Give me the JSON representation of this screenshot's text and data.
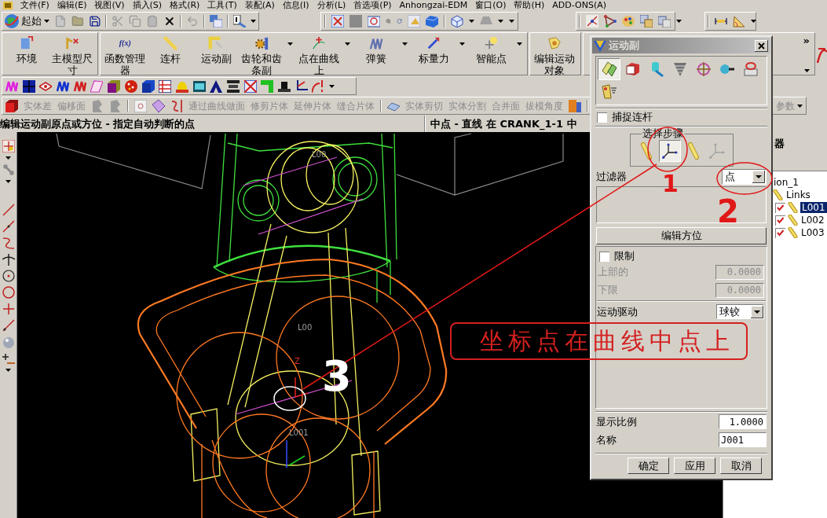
{
  "menu_bar": [
    "文件(F)",
    "编辑(E)",
    "视图(V)",
    "插入(S)",
    "格式(R)",
    "工具(T)",
    "装配(A)",
    "信息(I)",
    "分析(L)",
    "首选项(P)",
    "Anhongzai-EDM",
    "窗口(O)",
    "帮助(H)",
    "ADD-ONS(A)"
  ],
  "standard_toolbar": {
    "start_button": "起始"
  },
  "motion_toolbar": {
    "groups": [
      [
        {
          "label": "环境",
          "dropdown": false
        },
        {
          "label": "主模型尺寸",
          "dropdown": false
        }
      ],
      [
        {
          "label": "函数管理器",
          "dropdown": false,
          "icon_text": "f(x)"
        },
        {
          "label": "连杆",
          "dropdown": false
        },
        {
          "label": "运动副",
          "dropdown": false
        },
        {
          "label": "齿轮和齿条副",
          "dropdown": true
        },
        {
          "label": "点在曲线上",
          "dropdown": true
        },
        {
          "label": "弹簧",
          "dropdown": true
        },
        {
          "label": "标量力",
          "dropdown": true
        },
        {
          "label": "智能点",
          "dropdown": true
        }
      ],
      [
        {
          "label": "编辑运动对象",
          "dropdown": false
        }
      ]
    ],
    "overflow": "»"
  },
  "feature_toolbar": {
    "groups": [
      [
        {
          "label": "实体差",
          "disabled": true
        },
        {
          "label": "偏移面",
          "disabled": true
        }
      ],
      [
        {
          "label": "通过曲线做面",
          "disabled": true
        },
        {
          "label": "修剪片体",
          "disabled": true
        },
        {
          "label": "延伸片体",
          "disabled": true
        },
        {
          "label": "缝合片体",
          "disabled": true
        }
      ],
      [
        {
          "label": "实体剪切",
          "disabled": true
        },
        {
          "label": "实体分割",
          "disabled": true
        },
        {
          "label": "合并面",
          "disabled": true
        },
        {
          "label": "拔模角度",
          "disabled": true
        }
      ]
    ],
    "trailing": {
      "label": "参数",
      "disabled": true
    }
  },
  "status_bar": {
    "prompt": "编辑运动副原点或方位 - 指定自动判断的点",
    "selection": "中点 - 直线 在 CRANK_1-1 中"
  },
  "viewport": {
    "labels": [
      {
        "text": "L00",
        "kind": "link"
      },
      {
        "text": "L00",
        "kind": "link"
      },
      {
        "text": "L001",
        "kind": "link"
      },
      {
        "text": "Z",
        "kind": "axis"
      }
    ]
  },
  "navigator": {
    "title": "器",
    "tree": [
      {
        "label": "ion_1",
        "selected": false,
        "children": [
          {
            "label": "Links",
            "selected": false,
            "children": [
              {
                "label": "L001",
                "checked": true,
                "selected": true
              },
              {
                "label": "L002",
                "checked": true,
                "selected": false
              },
              {
                "label": "L003",
                "checked": true,
                "selected": false
              }
            ]
          }
        ]
      }
    ]
  },
  "dialog": {
    "title": "运动副",
    "joint_types": [
      {
        "selected": true
      },
      {
        "selected": false
      },
      {
        "selected": false
      },
      {
        "selected": false
      },
      {
        "selected": false
      },
      {
        "selected": false
      },
      {
        "selected": false
      },
      {
        "selected": false
      }
    ],
    "snap_link": {
      "label": "捕捉连杆",
      "checked": false
    },
    "selection_steps": {
      "title": "选择步骤",
      "steps": [
        {
          "kind": "link",
          "selected": false,
          "disabled": false
        },
        {
          "kind": "orient",
          "selected": true,
          "disabled": false
        },
        {
          "kind": "link",
          "selected": false,
          "disabled": false
        },
        {
          "kind": "orient",
          "selected": false,
          "disabled": true
        }
      ]
    },
    "filter": {
      "label": "过滤器",
      "value": "点"
    },
    "edit_orientation": "编辑方位",
    "limits": {
      "label": "限制",
      "checked": false,
      "upper": {
        "label": "上部的",
        "value": "0.0000",
        "disabled": true
      },
      "lower": {
        "label": "下限",
        "value": "0.0000",
        "disabled": true
      }
    },
    "motion_driver": {
      "label": "运动驱动",
      "value": "球铰"
    },
    "display_scale": {
      "label": "显示比例",
      "value": "1.0000"
    },
    "name": {
      "label": "名称",
      "value": "J001"
    },
    "buttons": [
      "确定",
      "应用",
      "取消"
    ]
  },
  "annotations": {
    "callout": "坐标点在曲线中点上",
    "step_numbers": [
      {
        "text": "1",
        "color": "#e01818"
      },
      {
        "text": "2",
        "color": "#e01818"
      },
      {
        "text": "3",
        "color": "#ffffff"
      }
    ]
  }
}
